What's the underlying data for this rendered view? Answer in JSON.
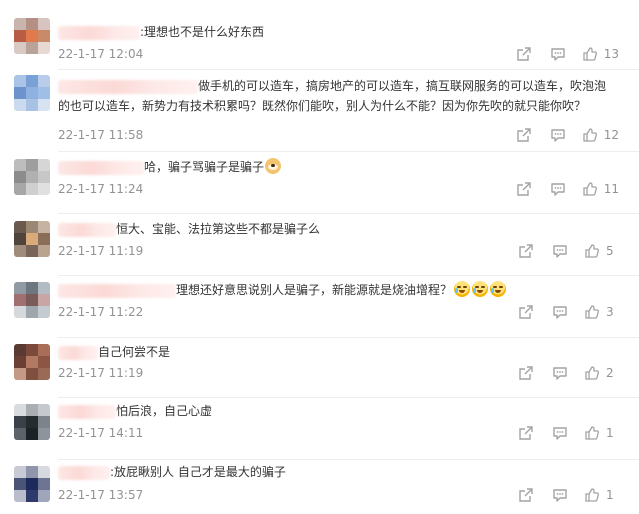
{
  "comments": [
    {
      "text": ":理想也不是什么好东西",
      "time": "22-1-17 12:04",
      "likes": "13",
      "avatar_colors": [
        "#c9b5ad",
        "#b48f83",
        "#d8c4be",
        "#b85c45",
        "#e07a4c",
        "#c98a6a",
        "#d9c9c4",
        "#b9a29a",
        "#e6d8d3"
      ]
    },
    {
      "text": "做手机的可以造车，搞房地产的可以造车，搞互联网服务的可以造车，吹泡泡\n的也可以造车，新势力有技术积累吗？既然你们能吹，别人为什么不能？因为你先吹的就只能你吹？",
      "time": "22-1-17 11:58",
      "likes": "12",
      "avatar_colors": [
        "#a9c4e6",
        "#7aa1d6",
        "#b7cde9",
        "#6d93cc",
        "#8fb1df",
        "#9fbfe6",
        "#cbdaef",
        "#a8c2e4",
        "#d7e3f3"
      ]
    },
    {
      "text": "哈，骗子骂骗子是骗子",
      "time": "22-1-17 11:24",
      "likes": "11",
      "avatar_colors": [
        "#bdbdbd",
        "#9e9e9e",
        "#d6d6d6",
        "#8c8c8c",
        "#b0b0b0",
        "#c7c7c7",
        "#a7a7a7",
        "#cfcfcf",
        "#e0e0e0"
      ]
    },
    {
      "text": "恒大、宝能、法拉第这些不都是骗子么",
      "time": "22-1-17 11:19",
      "likes": "5",
      "avatar_colors": [
        "#6a5a4e",
        "#9c8674",
        "#c7b3a1",
        "#4f433b",
        "#d9aa7a",
        "#8a6e58",
        "#a08c7b",
        "#7a655a",
        "#b9a491"
      ]
    },
    {
      "text": "理想还好意思说别人是骗子，新能源就是烧油增程？",
      "time": "22-1-17 11:22",
      "likes": "3",
      "avatar_colors": [
        "#8f9aa3",
        "#6c7780",
        "#b3bcc3",
        "#a07070",
        "#7b5a5a",
        "#c9a5a5",
        "#d6d9dc",
        "#9ea7ae",
        "#c4cbd0"
      ]
    },
    {
      "text": "自己何尝不是",
      "time": "22-1-17 11:19",
      "likes": "2",
      "avatar_colors": [
        "#5a3b32",
        "#7c4a3a",
        "#a86e58",
        "#6b3f34",
        "#b27a62",
        "#8d5644",
        "#c49a86",
        "#7f5040",
        "#9a6a56"
      ]
    },
    {
      "text": "怕后浪，自己心虚",
      "time": "22-1-17 14:11",
      "likes": "1",
      "avatar_colors": [
        "#d9dcdf",
        "#a9aeb3",
        "#c6cacf",
        "#3b4148",
        "#262b30",
        "#7c838a",
        "#5c6369",
        "#1d2227",
        "#8d949b"
      ]
    },
    {
      "text": ":放屁瞅别人 自己才是最大的骗子",
      "time": "22-1-17 13:57",
      "likes": "1",
      "avatar_colors": [
        "#c8cbd6",
        "#8f95aa",
        "#d7d9e1",
        "#4a5476",
        "#1f2a5c",
        "#6d7593",
        "#b9bdcb",
        "#2e3a6c",
        "#a0a6ba"
      ]
    }
  ],
  "icons": {
    "share": "share-icon",
    "reply": "comment-icon",
    "like": "thumbs-up-icon"
  },
  "colors": {
    "text": "#333333",
    "meta": "#939393",
    "divider": "#eeeeee",
    "name_blur": "#fbd9d6"
  }
}
